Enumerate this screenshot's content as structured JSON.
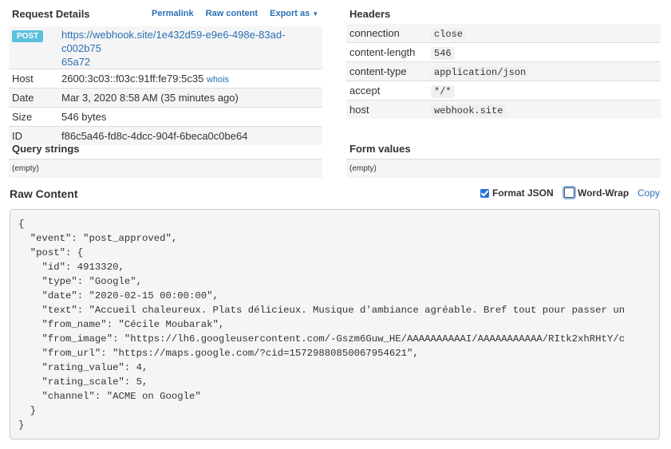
{
  "request": {
    "title": "Request Details",
    "links": {
      "permalink": "Permalink",
      "raw": "Raw content",
      "export": "Export as"
    },
    "method": "POST",
    "url_line1": "https://webhook.site/1e432d59-e9e6-498e-83ad-c002b75",
    "url_line2": "65a72",
    "rows": {
      "host": {
        "label": "Host",
        "value": "2600:3c03::f03c:91ff:fe79:5c35",
        "extra": "whois"
      },
      "date": {
        "label": "Date",
        "value": "Mar 3, 2020 8:58 AM (35 minutes ago)"
      },
      "size": {
        "label": "Size",
        "value": "546 bytes"
      },
      "id": {
        "label": "ID",
        "value": "f86c5a46-fd8c-4dcc-904f-6beca0c0be64"
      }
    }
  },
  "headers": {
    "title": "Headers",
    "items": [
      {
        "key": "connection",
        "value": "close"
      },
      {
        "key": "content-length",
        "value": "546"
      },
      {
        "key": "content-type",
        "value": "application/json"
      },
      {
        "key": "accept",
        "value": "*/*"
      },
      {
        "key": "host",
        "value": "webhook.site"
      }
    ]
  },
  "query": {
    "title": "Query strings",
    "empty": "(empty)"
  },
  "form": {
    "title": "Form values",
    "empty": "(empty)"
  },
  "raw": {
    "title": "Raw Content",
    "format_json": "Format JSON",
    "format_json_checked": true,
    "word_wrap": "Word-Wrap",
    "word_wrap_checked": false,
    "copy": "Copy",
    "lines": [
      "{",
      "  \"event\": \"post_approved\",",
      "  \"post\": {",
      "    \"id\": 4913320,",
      "    \"type\": \"Google\",",
      "    \"date\": \"2020-02-15 00:00:00\",",
      "    \"text\": \"Accueil chaleureux. Plats délicieux. Musique d'ambiance agréable. Bref tout pour passer un",
      "    \"from_name\": \"Cécile Moubarak\",",
      "    \"from_image\": \"https://lh6.googleusercontent.com/-Gszm6Guw_HE/AAAAAAAAAAI/AAAAAAAAAAA/RItk2xhRHtY/c",
      "    \"from_url\": \"https://maps.google.com/?cid=15729880850067954621\",",
      "    \"rating_value\": 4,",
      "    \"rating_scale\": 5,",
      "    \"channel\": \"ACME on Google\"",
      "  }",
      "}"
    ]
  }
}
